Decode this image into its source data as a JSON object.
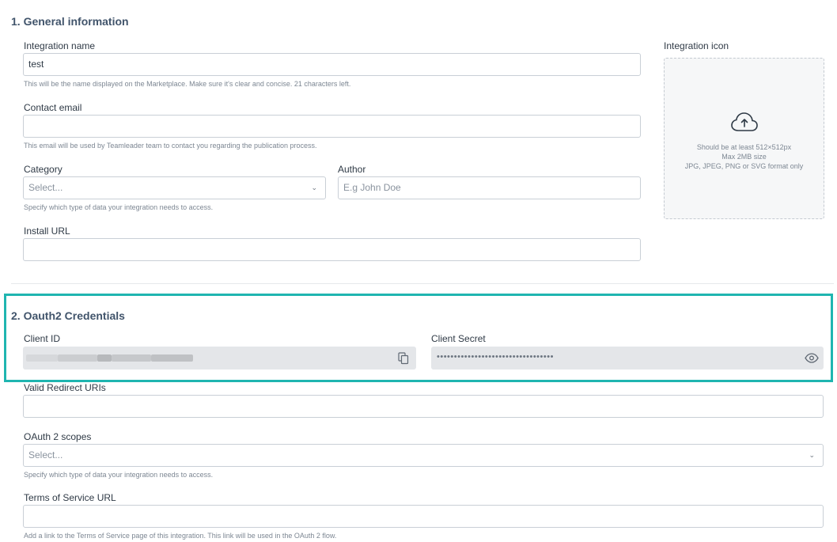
{
  "general": {
    "section_title": "1. General information",
    "integration_name": {
      "label": "Integration name",
      "value": "test",
      "help": "This will be the name displayed on the Marketplace. Make sure it's clear and concise. 21 characters left."
    },
    "contact_email": {
      "label": "Contact email",
      "value": "",
      "help": "This email will be used by Teamleader team to contact you regarding the publication process."
    },
    "category": {
      "label": "Category",
      "placeholder": "Select...",
      "help": "Specify which type of data your integration needs to access."
    },
    "author": {
      "label": "Author",
      "placeholder": "E.g John Doe"
    },
    "install_url": {
      "label": "Install URL",
      "value": ""
    },
    "integration_icon": {
      "label": "Integration icon",
      "line1": "Should be at least 512×512px",
      "line2": "Max 2MB size",
      "line3": "JPG, JPEG, PNG or SVG format only",
      "icon": "cloud-upload-icon"
    }
  },
  "oauth": {
    "section_title": "2. Oauth2 Credentials",
    "client_id": {
      "label": "Client ID",
      "copy_icon": "copy-icon"
    },
    "client_secret": {
      "label": "Client Secret",
      "value": "••••••••••••••••••••••••••••••••••",
      "reveal_icon": "eye-icon"
    },
    "redirect_uris": {
      "label": "Valid Redirect URIs",
      "value": ""
    },
    "scopes": {
      "label": "OAuth 2 scopes",
      "placeholder": "Select...",
      "help": "Specify which type of data your integration needs to access."
    },
    "tos_url": {
      "label": "Terms of Service URL",
      "value": "",
      "help": "Add a link to the Terms of Service page of this integration. This link will be used in the OAuth 2 flow."
    }
  },
  "colors": {
    "highlight": "#1fb5b0",
    "section_title": "#41546b",
    "readonly_bg": "#e4e6e9"
  }
}
